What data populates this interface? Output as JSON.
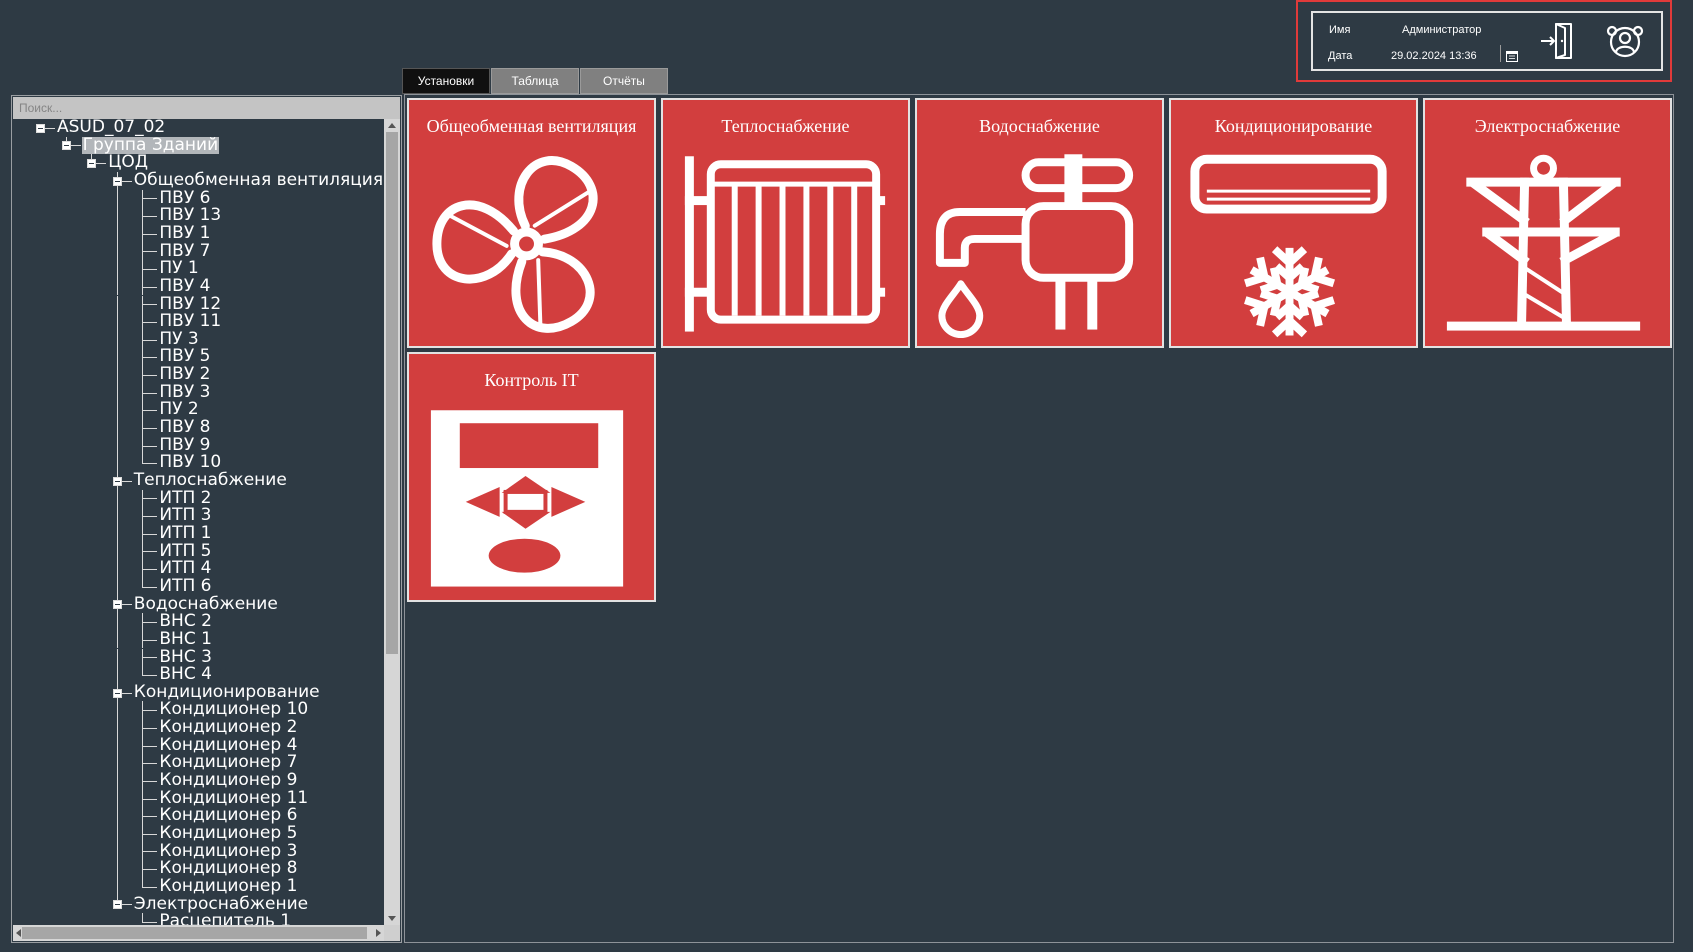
{
  "header": {
    "name_label": "Имя",
    "name_value": "Администратор",
    "date_label": "Дата",
    "date_value": "29.02.2024 13:36",
    "icons": {
      "calendar": "calendar-icon",
      "logout": "logout-icon",
      "users": "user-group-icon"
    }
  },
  "search": {
    "placeholder": "Поиск..."
  },
  "tabs": [
    {
      "label": "Установки",
      "active": true
    },
    {
      "label": "Таблица",
      "active": false
    },
    {
      "label": "Отчёты",
      "active": false
    }
  ],
  "tree": {
    "label": "ASUD_07_02",
    "expanded": true,
    "children": [
      {
        "label": "Группа Зданий",
        "selected": true,
        "expanded": true,
        "children": [
          {
            "label": "ЦОД",
            "expanded": true,
            "children": [
              {
                "label": "Общеобменная вентиляция",
                "expanded": true,
                "children": [
                  {
                    "label": "ПВУ 6"
                  },
                  {
                    "label": "ПВУ 13"
                  },
                  {
                    "label": "ПВУ 1"
                  },
                  {
                    "label": "ПВУ 7"
                  },
                  {
                    "label": "ПУ 1"
                  },
                  {
                    "label": "ПВУ 4"
                  },
                  {
                    "label": "ПВУ 12"
                  },
                  {
                    "label": "ПВУ 11"
                  },
                  {
                    "label": "ПУ 3"
                  },
                  {
                    "label": "ПВУ 5"
                  },
                  {
                    "label": "ПВУ 2"
                  },
                  {
                    "label": "ПВУ 3"
                  },
                  {
                    "label": "ПУ 2"
                  },
                  {
                    "label": "ПВУ 8"
                  },
                  {
                    "label": "ПВУ 9"
                  },
                  {
                    "label": "ПВУ 10"
                  }
                ]
              },
              {
                "label": "Теплоснабжение",
                "expanded": true,
                "children": [
                  {
                    "label": "ИТП 2"
                  },
                  {
                    "label": "ИТП 3"
                  },
                  {
                    "label": "ИТП 1"
                  },
                  {
                    "label": "ИТП 5"
                  },
                  {
                    "label": "ИТП 4"
                  },
                  {
                    "label": "ИТП 6"
                  }
                ]
              },
              {
                "label": "Водоснабжение",
                "expanded": true,
                "children": [
                  {
                    "label": "ВНС 2"
                  },
                  {
                    "label": "ВНС 1"
                  },
                  {
                    "label": "ВНС 3"
                  },
                  {
                    "label": "ВНС 4"
                  }
                ]
              },
              {
                "label": "Кондиционирование",
                "expanded": true,
                "children": [
                  {
                    "label": "Кондиционер 10"
                  },
                  {
                    "label": "Кондиционер 2"
                  },
                  {
                    "label": "Кондиционер 4"
                  },
                  {
                    "label": "Кондиционер 7"
                  },
                  {
                    "label": "Кондиционер 9"
                  },
                  {
                    "label": "Кондиционер 11"
                  },
                  {
                    "label": "Кондиционер 6"
                  },
                  {
                    "label": "Кондиционер 5"
                  },
                  {
                    "label": "Кондиционер 3"
                  },
                  {
                    "label": "Кондиционер 8"
                  },
                  {
                    "label": "Кондиционер 1"
                  }
                ]
              },
              {
                "label": "Электроснабжение",
                "expanded": true,
                "children": [
                  {
                    "label": "Расцепитель 1"
                  }
                ]
              }
            ]
          }
        ]
      }
    ]
  },
  "tiles": [
    {
      "title": "Общеобменная вентиляция",
      "icon": "fan-icon"
    },
    {
      "title": "Теплоснабжение",
      "icon": "radiator-icon"
    },
    {
      "title": "Водоснабжение",
      "icon": "water-tap-icon"
    },
    {
      "title": "Кондиционирование",
      "icon": "air-conditioner-icon"
    },
    {
      "title": "Электроснабжение",
      "icon": "power-pylon-icon"
    },
    {
      "title": "Контроль IT",
      "icon": "control-panel-icon"
    }
  ],
  "colors": {
    "background": "#2e3a44",
    "tile": "#d23e3e",
    "highlight_border": "#e03a3a",
    "active_tab": "#101010",
    "inactive_tab": "#808080"
  }
}
